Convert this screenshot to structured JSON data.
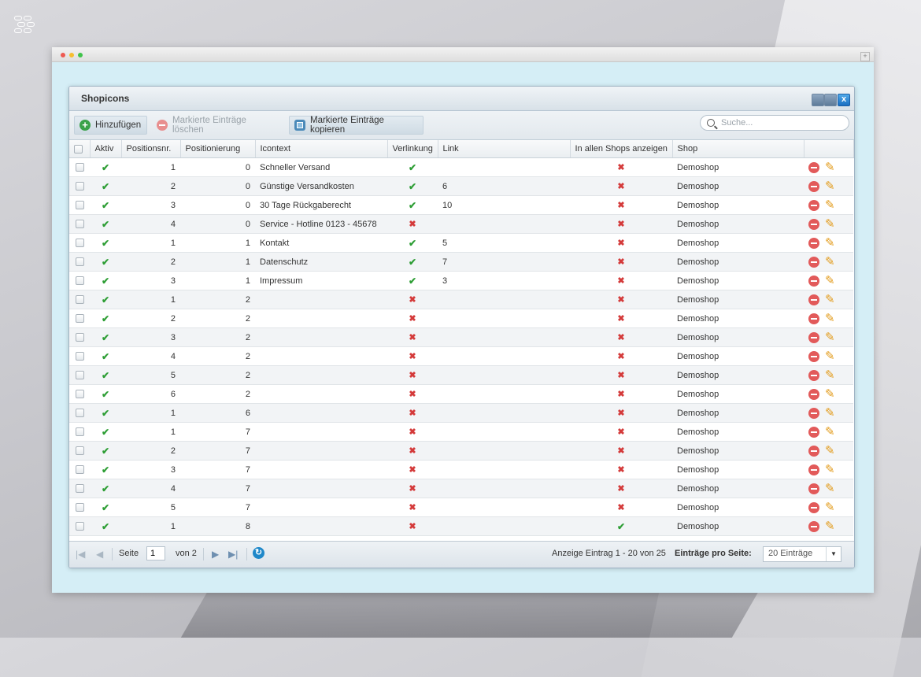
{
  "window": {
    "title": "Shopicons"
  },
  "toolbar": {
    "add_label": "Hinzufügen",
    "delete_label": "Markierte Einträge löschen",
    "copy_label": "Markierte Einträge kopieren",
    "search_placeholder": "Suche..."
  },
  "columns": [
    "Aktiv",
    "Positionsnr.",
    "Positionierung",
    "Icontext",
    "Verlinkung",
    "Link",
    "In allen Shops anzeigen",
    "Shop"
  ],
  "rows": [
    {
      "aktiv": "true",
      "posnr": "1",
      "positionierung": "0",
      "icontext": "Schneller Versand",
      "verlinkung": "true",
      "link": "",
      "alle_shops": "false",
      "shop": "Demoshop"
    },
    {
      "aktiv": "true",
      "posnr": "2",
      "positionierung": "0",
      "icontext": "Günstige Versandkosten",
      "verlinkung": "true",
      "link": "6",
      "alle_shops": "false",
      "shop": "Demoshop"
    },
    {
      "aktiv": "true",
      "posnr": "3",
      "positionierung": "0",
      "icontext": "30 Tage Rückgaberecht",
      "verlinkung": "true",
      "link": "10",
      "alle_shops": "false",
      "shop": "Demoshop"
    },
    {
      "aktiv": "true",
      "posnr": "4",
      "positionierung": "0",
      "icontext": "Service - Hotline 0123 - 45678",
      "verlinkung": "false",
      "link": "",
      "alle_shops": "false",
      "shop": "Demoshop"
    },
    {
      "aktiv": "true",
      "posnr": "1",
      "positionierung": "1",
      "icontext": "Kontakt",
      "verlinkung": "true",
      "link": "5",
      "alle_shops": "false",
      "shop": "Demoshop"
    },
    {
      "aktiv": "true",
      "posnr": "2",
      "positionierung": "1",
      "icontext": "Datenschutz",
      "verlinkung": "true",
      "link": "7",
      "alle_shops": "false",
      "shop": "Demoshop"
    },
    {
      "aktiv": "true",
      "posnr": "3",
      "positionierung": "1",
      "icontext": "Impressum",
      "verlinkung": "true",
      "link": "3",
      "alle_shops": "false",
      "shop": "Demoshop"
    },
    {
      "aktiv": "true",
      "posnr": "1",
      "positionierung": "2",
      "icontext": "",
      "verlinkung": "false",
      "link": "",
      "alle_shops": "false",
      "shop": "Demoshop"
    },
    {
      "aktiv": "true",
      "posnr": "2",
      "positionierung": "2",
      "icontext": "",
      "verlinkung": "false",
      "link": "",
      "alle_shops": "false",
      "shop": "Demoshop"
    },
    {
      "aktiv": "true",
      "posnr": "3",
      "positionierung": "2",
      "icontext": "",
      "verlinkung": "false",
      "link": "",
      "alle_shops": "false",
      "shop": "Demoshop"
    },
    {
      "aktiv": "true",
      "posnr": "4",
      "positionierung": "2",
      "icontext": "",
      "verlinkung": "false",
      "link": "",
      "alle_shops": "false",
      "shop": "Demoshop"
    },
    {
      "aktiv": "true",
      "posnr": "5",
      "positionierung": "2",
      "icontext": "",
      "verlinkung": "false",
      "link": "",
      "alle_shops": "false",
      "shop": "Demoshop"
    },
    {
      "aktiv": "true",
      "posnr": "6",
      "positionierung": "2",
      "icontext": "",
      "verlinkung": "false",
      "link": "",
      "alle_shops": "false",
      "shop": "Demoshop"
    },
    {
      "aktiv": "true",
      "posnr": "1",
      "positionierung": "6",
      "icontext": "",
      "verlinkung": "false",
      "link": "",
      "alle_shops": "false",
      "shop": "Demoshop"
    },
    {
      "aktiv": "true",
      "posnr": "1",
      "positionierung": "7",
      "icontext": "",
      "verlinkung": "false",
      "link": "",
      "alle_shops": "false",
      "shop": "Demoshop"
    },
    {
      "aktiv": "true",
      "posnr": "2",
      "positionierung": "7",
      "icontext": "",
      "verlinkung": "false",
      "link": "",
      "alle_shops": "false",
      "shop": "Demoshop"
    },
    {
      "aktiv": "true",
      "posnr": "3",
      "positionierung": "7",
      "icontext": "",
      "verlinkung": "false",
      "link": "",
      "alle_shops": "false",
      "shop": "Demoshop"
    },
    {
      "aktiv": "true",
      "posnr": "4",
      "positionierung": "7",
      "icontext": "",
      "verlinkung": "false",
      "link": "",
      "alle_shops": "false",
      "shop": "Demoshop"
    },
    {
      "aktiv": "true",
      "posnr": "5",
      "positionierung": "7",
      "icontext": "",
      "verlinkung": "false",
      "link": "",
      "alle_shops": "false",
      "shop": "Demoshop"
    },
    {
      "aktiv": "true",
      "posnr": "1",
      "positionierung": "8",
      "icontext": "",
      "verlinkung": "false",
      "link": "",
      "alle_shops": "true",
      "shop": "Demoshop"
    }
  ],
  "pager": {
    "page_label": "Seite",
    "page_value": "1",
    "of_label": "von 2",
    "info": "Anzeige Eintrag 1 - 20 von 25",
    "per_page_label": "Einträge pro Seite:",
    "per_page_value": "20 Einträge"
  },
  "icons": {
    "check": "✔",
    "cross": "✖",
    "edit": "✎",
    "refresh": "↻"
  },
  "colors": {
    "check": "#2e9e35",
    "cross": "#d43a3a",
    "delete": "#e25a5a",
    "edit": "#e29a18",
    "accent": "#1f88c9"
  }
}
